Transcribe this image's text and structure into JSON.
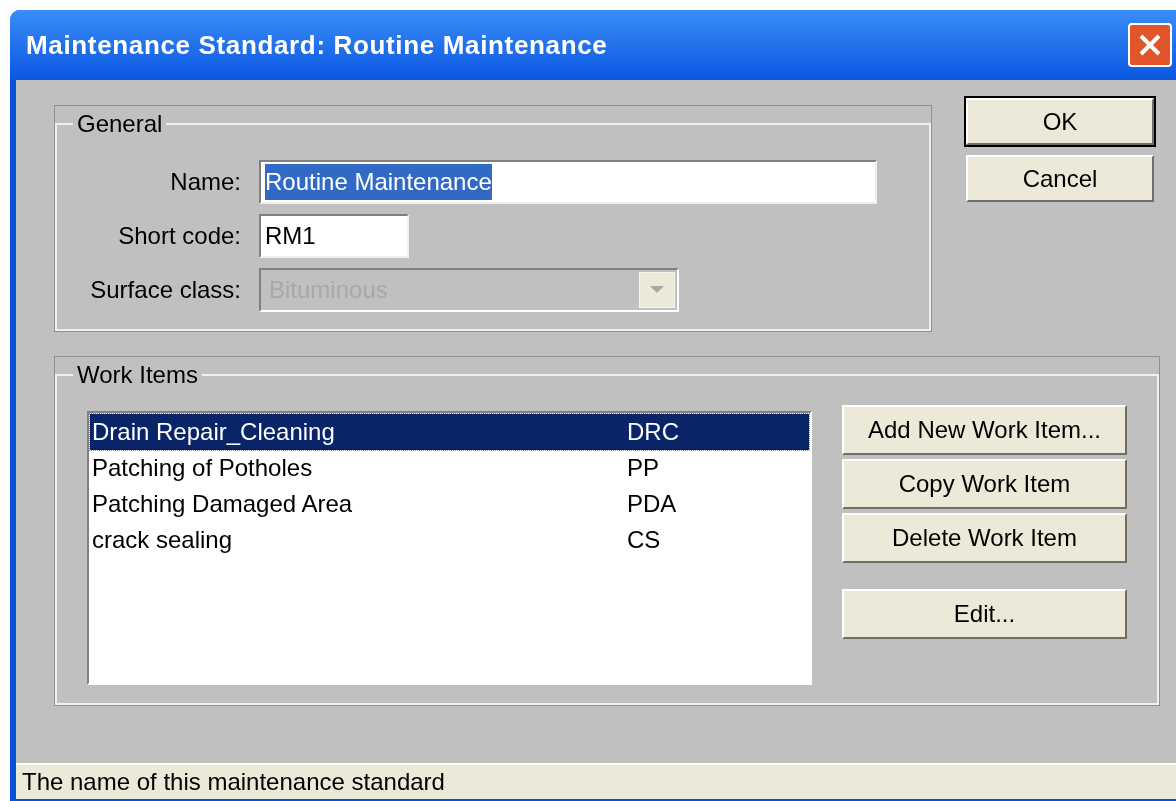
{
  "window": {
    "title": "Maintenance Standard: Routine Maintenance"
  },
  "general": {
    "title": "General",
    "fields": [
      {
        "kind": "text",
        "label": "Name:",
        "value": "Routine Maintenance",
        "highlighted": true
      },
      {
        "kind": "text",
        "label": "Short code:",
        "value": "RM1"
      },
      {
        "kind": "combo",
        "label": "Surface class:",
        "value": "Bituminous",
        "disabled": true
      }
    ]
  },
  "dialog_buttons": [
    {
      "label": "OK",
      "default": true
    },
    {
      "label": "Cancel",
      "default": false
    }
  ],
  "work_items": {
    "title": "Work Items",
    "rows": [
      {
        "name": "Drain Repair_Cleaning",
        "code": "DRC",
        "selected": true
      },
      {
        "name": "Patching of Potholes",
        "code": "PP",
        "selected": false
      },
      {
        "name": "Patching Damaged Area",
        "code": "PDA",
        "selected": false
      },
      {
        "name": "crack sealing",
        "code": "CS",
        "selected": false
      }
    ],
    "buttons": [
      "Add New Work Item...",
      "Copy Work Item",
      "Delete Work Item",
      "Edit..."
    ]
  },
  "status_bar": "The name of this maintenance standard"
}
